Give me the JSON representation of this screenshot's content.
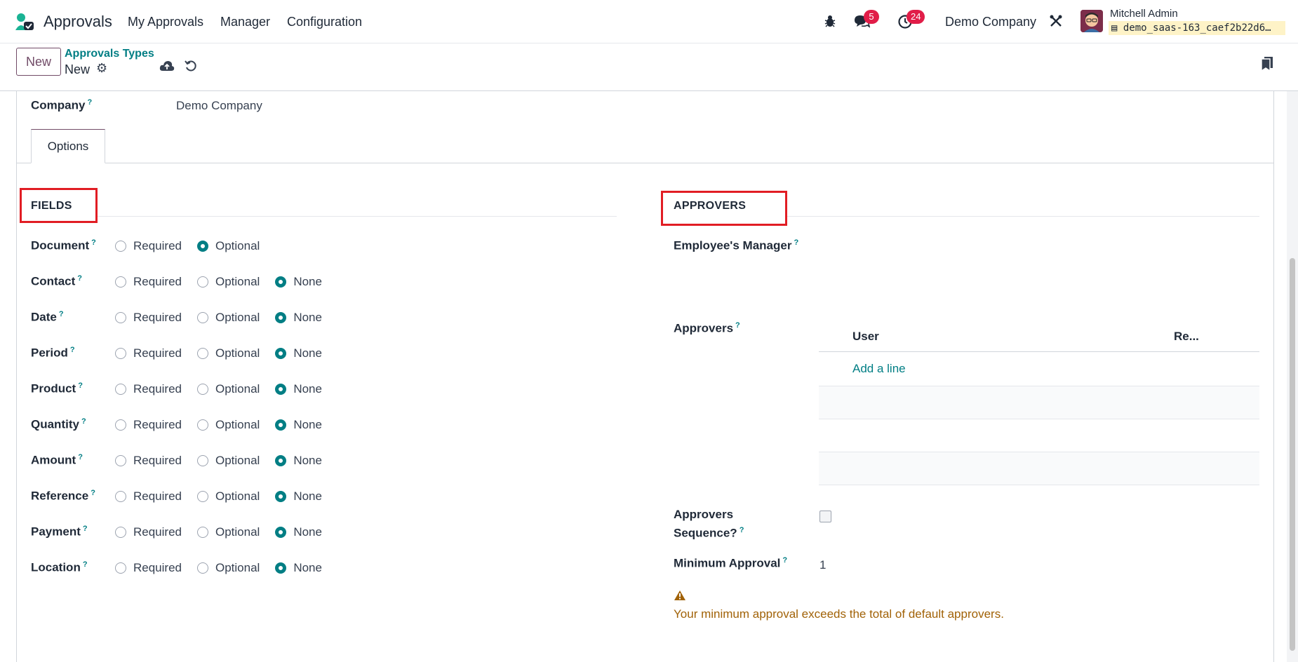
{
  "navbar": {
    "app_name": "Approvals",
    "menu": [
      "My Approvals",
      "Manager",
      "Configuration"
    ],
    "messages_count": "5",
    "activities_count": "24",
    "company": "Demo Company",
    "user_name": "Mitchell Admin",
    "database": "demo_saas-163_caef2b22d6…"
  },
  "control_panel": {
    "new_label": "New",
    "breadcrumb": "Approvals Types",
    "record_name": "New"
  },
  "form": {
    "company_label": "Company",
    "company_value": "Demo Company",
    "tab_label": "Options",
    "fields_section": "FIELDS",
    "approvers_section": "APPROVERS",
    "field_rows": [
      {
        "label": "Document",
        "options": [
          "Required",
          "Optional"
        ],
        "selected": "Optional"
      },
      {
        "label": "Contact",
        "options": [
          "Required",
          "Optional",
          "None"
        ],
        "selected": "None"
      },
      {
        "label": "Date",
        "options": [
          "Required",
          "Optional",
          "None"
        ],
        "selected": "None"
      },
      {
        "label": "Period",
        "options": [
          "Required",
          "Optional",
          "None"
        ],
        "selected": "None"
      },
      {
        "label": "Product",
        "options": [
          "Required",
          "Optional",
          "None"
        ],
        "selected": "None"
      },
      {
        "label": "Quantity",
        "options": [
          "Required",
          "Optional",
          "None"
        ],
        "selected": "None"
      },
      {
        "label": "Amount",
        "options": [
          "Required",
          "Optional",
          "None"
        ],
        "selected": "None"
      },
      {
        "label": "Reference",
        "options": [
          "Required",
          "Optional",
          "None"
        ],
        "selected": "None"
      },
      {
        "label": "Payment",
        "options": [
          "Required",
          "Optional",
          "None"
        ],
        "selected": "None"
      },
      {
        "label": "Location",
        "options": [
          "Required",
          "Optional",
          "None"
        ],
        "selected": "None"
      }
    ],
    "employee_manager_label": "Employee's Manager",
    "approvers_label": "Approvers",
    "approvers_table": {
      "col_user": "User",
      "col_required": "Re...",
      "add_line": "Add a line"
    },
    "sequence_label_1": "Approvers",
    "sequence_label_2": "Sequence?",
    "min_approval_label": "Minimum Approval",
    "min_approval_value": "1",
    "warning": "Your minimum approval exceeds the total of default approvers."
  },
  "colors": {
    "accent": "#017e84",
    "brand": "#714b67",
    "highlight": "#e11d24",
    "warning": "#a16207"
  }
}
